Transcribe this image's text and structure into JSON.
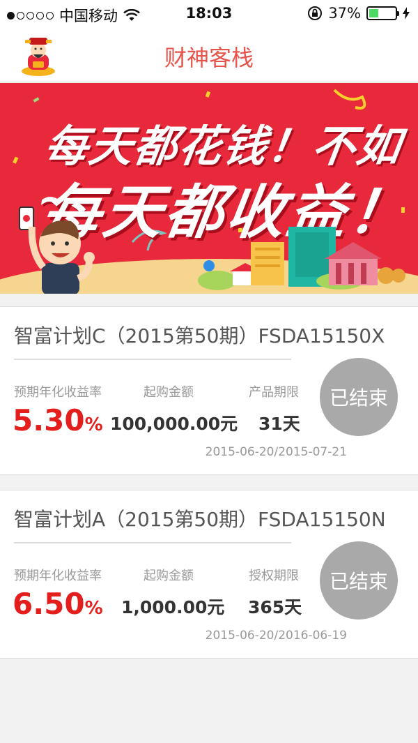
{
  "status_bar": {
    "carrier": "中国移动",
    "time": "18:03",
    "battery_percent": "37%",
    "battery_level": 0.37,
    "signal_dots_filled": 1,
    "icons": [
      "signal-dots-icon",
      "wifi-icon",
      "rotation-lock-icon",
      "battery-icon",
      "charging-icon"
    ]
  },
  "header": {
    "title": "财神客栈",
    "logo_icon": "fortune-god-logo",
    "title_color": "#e7544b"
  },
  "banner": {
    "line1": "每天都花钱！不如~",
    "line2": "每天都收益！",
    "background_color": "#e8293b"
  },
  "products": [
    {
      "title": "智富计划C（2015第50期）FSDA15150X",
      "rate_label": "预期年化收益率",
      "rate_value": "5.30",
      "rate_unit": "%",
      "amount_label": "起购金额",
      "amount_value": "100,000.00元",
      "term_label": "产品期限",
      "term_value": "31天",
      "date_range": "2015-06-20/2015-07-21",
      "status": "已结束"
    },
    {
      "title": "智富计划A（2015第50期）FSDA15150N",
      "rate_label": "预期年化收益率",
      "rate_value": "6.50",
      "rate_unit": "%",
      "amount_label": "起购金额",
      "amount_value": "1,000.00元",
      "term_label": "授权期限",
      "term_value": "365天",
      "date_range": "2015-06-20/2016-06-19",
      "status": "已结束"
    }
  ],
  "colors": {
    "accent_red": "#e41d1d",
    "ended_gray": "#a9a9a9"
  }
}
